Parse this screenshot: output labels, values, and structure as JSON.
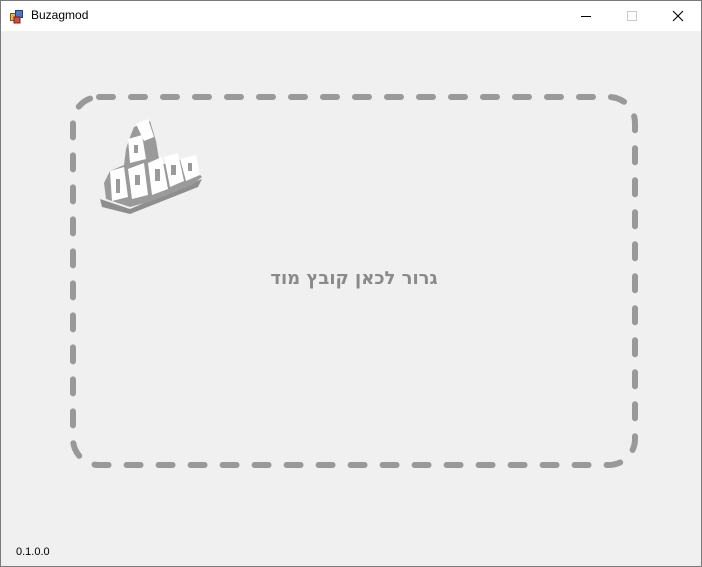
{
  "window": {
    "title": "Buzagmod"
  },
  "drop_zone": {
    "text": "גרור לכאן קובץ מוד",
    "border_color": "#999999",
    "text_color": "#8a8a8a"
  },
  "status": {
    "version": "0.1.0.0"
  }
}
